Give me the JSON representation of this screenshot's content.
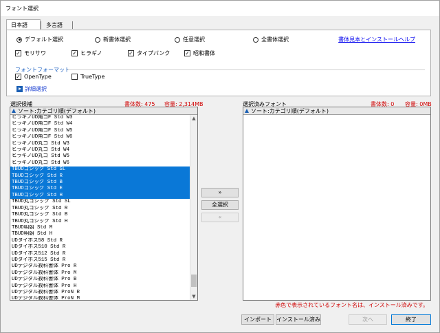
{
  "window": {
    "title": "フォント選択"
  },
  "tabs": [
    {
      "label": "日本語",
      "active": true
    },
    {
      "label": "多言語",
      "active": false
    }
  ],
  "selection_modes": [
    {
      "label": "デフォルト選択",
      "selected": true
    },
    {
      "label": "新書体選択",
      "selected": false
    },
    {
      "label": "任意選択",
      "selected": false
    },
    {
      "label": "全書体選択",
      "selected": false
    }
  ],
  "help_link": "書体見本とインストールヘルプ",
  "vendors": [
    {
      "label": "モリサワ",
      "checked": true
    },
    {
      "label": "ヒラギノ",
      "checked": true
    },
    {
      "label": "タイプバンク",
      "checked": true
    },
    {
      "label": "昭和書体",
      "checked": true
    }
  ],
  "format": {
    "label": "フォントフォーマット",
    "options": [
      {
        "label": "OpenType",
        "checked": true
      },
      {
        "label": "TrueType",
        "checked": false
      }
    ]
  },
  "advanced_label": "詳細選択",
  "candidates": {
    "header": "選択候補",
    "count_text": "書体数: 475",
    "size_text": "容量: 2,314MB",
    "sort_label": "ソート:カテゴリ順(デフォルト)",
    "items": [
      {
        "name": "ヒラギノUD角ゴF Std W3",
        "selected": false
      },
      {
        "name": "ヒラギノUD角ゴF Std W4",
        "selected": false
      },
      {
        "name": "ヒラギノUD角ゴF Std W5",
        "selected": false
      },
      {
        "name": "ヒラギノUD角ゴF Std W6",
        "selected": false
      },
      {
        "name": "ヒラギノUD丸ゴ Std W3",
        "selected": false
      },
      {
        "name": "ヒラギノUD丸ゴ Std W4",
        "selected": false
      },
      {
        "name": "ヒラギノUD丸ゴ Std W5",
        "selected": false
      },
      {
        "name": "ヒラギノUD丸ゴ Std W6",
        "selected": false
      },
      {
        "name": "TBUDゴシック Std SL",
        "selected": true
      },
      {
        "name": "TBUDゴシック Std R",
        "selected": true
      },
      {
        "name": "TBUDゴシック Std B",
        "selected": true
      },
      {
        "name": "TBUDゴシック Std E",
        "selected": true
      },
      {
        "name": "TBUDゴシック Std H",
        "selected": true
      },
      {
        "name": "TBUD丸ゴシック Std SL",
        "selected": false
      },
      {
        "name": "TBUD丸ゴシック Std R",
        "selected": false
      },
      {
        "name": "TBUD丸ゴシック Std B",
        "selected": false
      },
      {
        "name": "TBUD丸ゴシック Std H",
        "selected": false
      },
      {
        "name": "TBUD明朝 Std M",
        "selected": false
      },
      {
        "name": "TBUD明朝 Std H",
        "selected": false
      },
      {
        "name": "UDタイポス58 Std R",
        "selected": false
      },
      {
        "name": "UDタイポス510 Std R",
        "selected": false
      },
      {
        "name": "UDタイポス512 Std R",
        "selected": false
      },
      {
        "name": "UDタイポス515 Std R",
        "selected": false
      },
      {
        "name": "UDデジタル教科書体 Pro R",
        "selected": false
      },
      {
        "name": "UDデジタル教科書体 Pro M",
        "selected": false
      },
      {
        "name": "UDデジタル教科書体 Pro B",
        "selected": false
      },
      {
        "name": "UDデジタル教科書体 Pro H",
        "selected": false
      },
      {
        "name": "UDデジタル教科書体 ProN R",
        "selected": false
      },
      {
        "name": "UDデジタル教科書体 ProN M",
        "selected": false
      },
      {
        "name": "UDデジタル教科書体 ProN B",
        "selected": false
      },
      {
        "name": "UDデジタル教科書体 ProN H",
        "selected": false
      },
      {
        "name": "UDデジタル教科書体 Std R",
        "selected": false
      },
      {
        "name": "UDデジタル教科書体 Std M",
        "selected": false
      },
      {
        "name": "UDデジタル教科書体 Std B",
        "selected": false
      }
    ]
  },
  "selected_fonts": {
    "header": "選択済みフォント",
    "count_text": "書体数: 0",
    "size_text": "容量: 0MB",
    "sort_label": "ソート:カテゴリ順(デフォルト)"
  },
  "buttons": {
    "add": "»",
    "select_all": "全選択",
    "remove": "«",
    "import": "インポート",
    "installed": "インストール済み",
    "next": "次へ",
    "finish": "終了"
  },
  "note": "赤色で表示されているフォント名は、インストール済みです。",
  "icons": {
    "sort": "sort-ascending-icon",
    "advanced": "expand-right-icon"
  }
}
